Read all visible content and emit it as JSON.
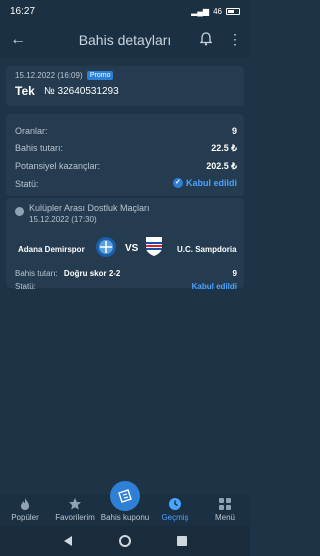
{
  "status_bar": {
    "time": "16:27",
    "battery": "46"
  },
  "header": {
    "title": "Bahis detayları"
  },
  "bet": {
    "date": "15.12.2022 (16:09)",
    "promo_badge": "Promo",
    "type": "Tek",
    "number": "№ 32640531293"
  },
  "summary": {
    "rows": [
      {
        "label": "Oranlar:",
        "value": "9"
      },
      {
        "label": "Bahis tutarı:",
        "value": "22.5 ₺"
      },
      {
        "label": "Potansiyel kazançlar:",
        "value": "202.5 ₺"
      }
    ],
    "status_label": "Statü:",
    "status_value": "Kabul edildi"
  },
  "event": {
    "league": "Kulüpler Arası Dostluk Maçları",
    "date": "15.12.2022 (17:30)",
    "home_team": "Adana Demirspor",
    "vs": "VS",
    "away_team": "U.C. Sampdoria",
    "bet_label": "Bahis tutarı:",
    "pick": "Doğru skor 2-2",
    "odd": "9",
    "status_label": "Statü:",
    "status_value": "Kabul edildi"
  },
  "nav": {
    "items": [
      {
        "label": "Popüler",
        "icon": "fire-icon"
      },
      {
        "label": "Favorilerim",
        "icon": "star-icon"
      },
      {
        "label": "Bahis kuponu",
        "icon": "ticket-icon"
      },
      {
        "label": "Geçmiş",
        "icon": "clock-icon"
      },
      {
        "label": "Menü",
        "icon": "grid-icon"
      }
    ],
    "active_index": 3
  },
  "colors": {
    "background": "#1f3346",
    "card": "#253b50",
    "accent": "#2d80d6",
    "status_accepted": "#4aa3ff"
  }
}
